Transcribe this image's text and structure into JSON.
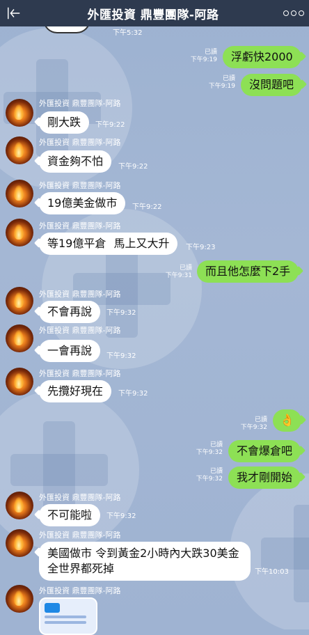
{
  "header": {
    "title": "外匯投資 鼎豐團隊-阿路"
  },
  "contact": {
    "name": "外匯投資 鼎豐團隊-阿路"
  },
  "read_label": "已讀",
  "top_time": "下午5:32",
  "messages": [
    {
      "text": "浮虧快2000",
      "time": "下午9:19"
    },
    {
      "text": "沒問題吧",
      "time": "下午9:19"
    },
    {
      "text": "剛大跌",
      "time": "下午9:22"
    },
    {
      "text": "資金夠不怕",
      "time": "下午9:22"
    },
    {
      "text": "19億美金做市",
      "time": "下午9:22"
    },
    {
      "text": "等19億平倉 馬上又大升",
      "time": "下午9:23"
    },
    {
      "text": "而且他怎麼下2手",
      "time": "下午9:31"
    },
    {
      "text": "不會再說",
      "time": "下午9:32"
    },
    {
      "text": "一會再說",
      "time": "下午9:32"
    },
    {
      "text": "先攬好現在",
      "time": "下午9:32"
    },
    {
      "text": "👌",
      "time": "下午9:32"
    },
    {
      "text": "不會爆倉吧",
      "time": "下午9:32"
    },
    {
      "text": "我才剛開始",
      "time": "下午9:32"
    },
    {
      "text": "不可能啦",
      "time": "下午9:32"
    },
    {
      "text": "美國做市 令到黃金2小時內大跌30美金 全世界都死掉",
      "time": "下午10:03"
    }
  ]
}
